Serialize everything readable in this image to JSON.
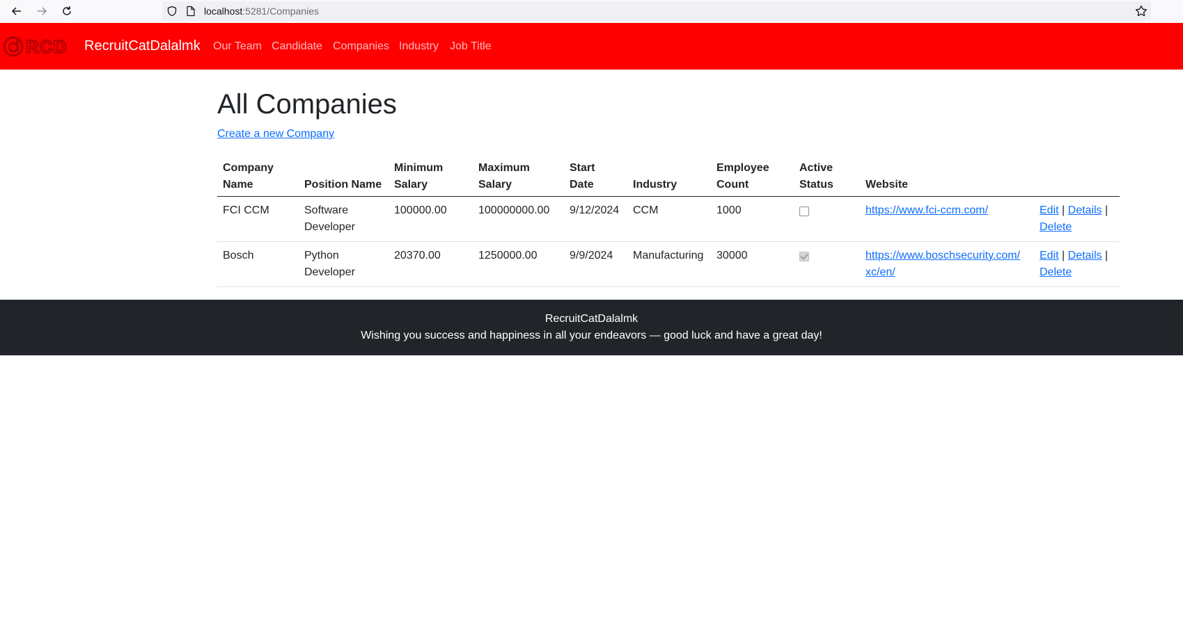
{
  "browser": {
    "url_host": "localhost",
    "url_path": ":5281/Companies"
  },
  "navbar": {
    "logo_text": "RCD",
    "brand": "RecruitCatDalalmk",
    "links": [
      {
        "label": "Our Team"
      },
      {
        "label": "Candidate"
      },
      {
        "label": "Companies"
      },
      {
        "label": "Industry"
      },
      {
        "label": "Job Title"
      }
    ]
  },
  "page": {
    "title": "All Companies",
    "create_link": "Create a new Company"
  },
  "table": {
    "headers": {
      "company_name": [
        "Company",
        "Name"
      ],
      "position_name": "Position Name",
      "minimum_salary": [
        "Minimum",
        "Salary"
      ],
      "maximum_salary": [
        "Maximum",
        "Salary"
      ],
      "start_date": [
        "Start",
        "Date"
      ],
      "industry": "Industry",
      "employee_count": [
        "Employee",
        "Count"
      ],
      "active_status": [
        "Active",
        "Status"
      ],
      "website": "Website"
    },
    "rows": [
      {
        "company_name": "FCI CCM",
        "position_name": [
          "Software",
          "Developer"
        ],
        "minimum_salary": "100000.00",
        "maximum_salary": "100000000.00",
        "start_date": "9/12/2024",
        "industry": "CCM",
        "employee_count": "1000",
        "active": false,
        "website": "https://www.fci-ccm.com/",
        "actions": {
          "edit": "Edit",
          "details": "Details",
          "delete": "Delete",
          "sep": "|"
        }
      },
      {
        "company_name": "Bosch",
        "position_name": [
          "Python",
          "Developer"
        ],
        "minimum_salary": "20370.00",
        "maximum_salary": "1250000.00",
        "start_date": "9/9/2024",
        "industry": "Manufacturing",
        "employee_count": "30000",
        "active": true,
        "website": [
          "https://www.boschsecurity.com/",
          "xc/en/"
        ],
        "actions": {
          "edit": "Edit",
          "details": "Details",
          "delete": "Delete",
          "sep": "|"
        }
      }
    ]
  },
  "footer": {
    "line1": "RecruitCatDalalmk",
    "line2": "Wishing you success and happiness in all your endeavors — good luck and have a great day!"
  },
  "colors": {
    "navbar_bg": "#ff0000",
    "footer_bg": "#212529",
    "link": "#0d6efd"
  },
  "icons": [
    "back-arrow-icon",
    "forward-arrow-icon",
    "reload-icon",
    "shield-icon",
    "page-icon",
    "bookmark-star-icon",
    "rcd-logo"
  ]
}
